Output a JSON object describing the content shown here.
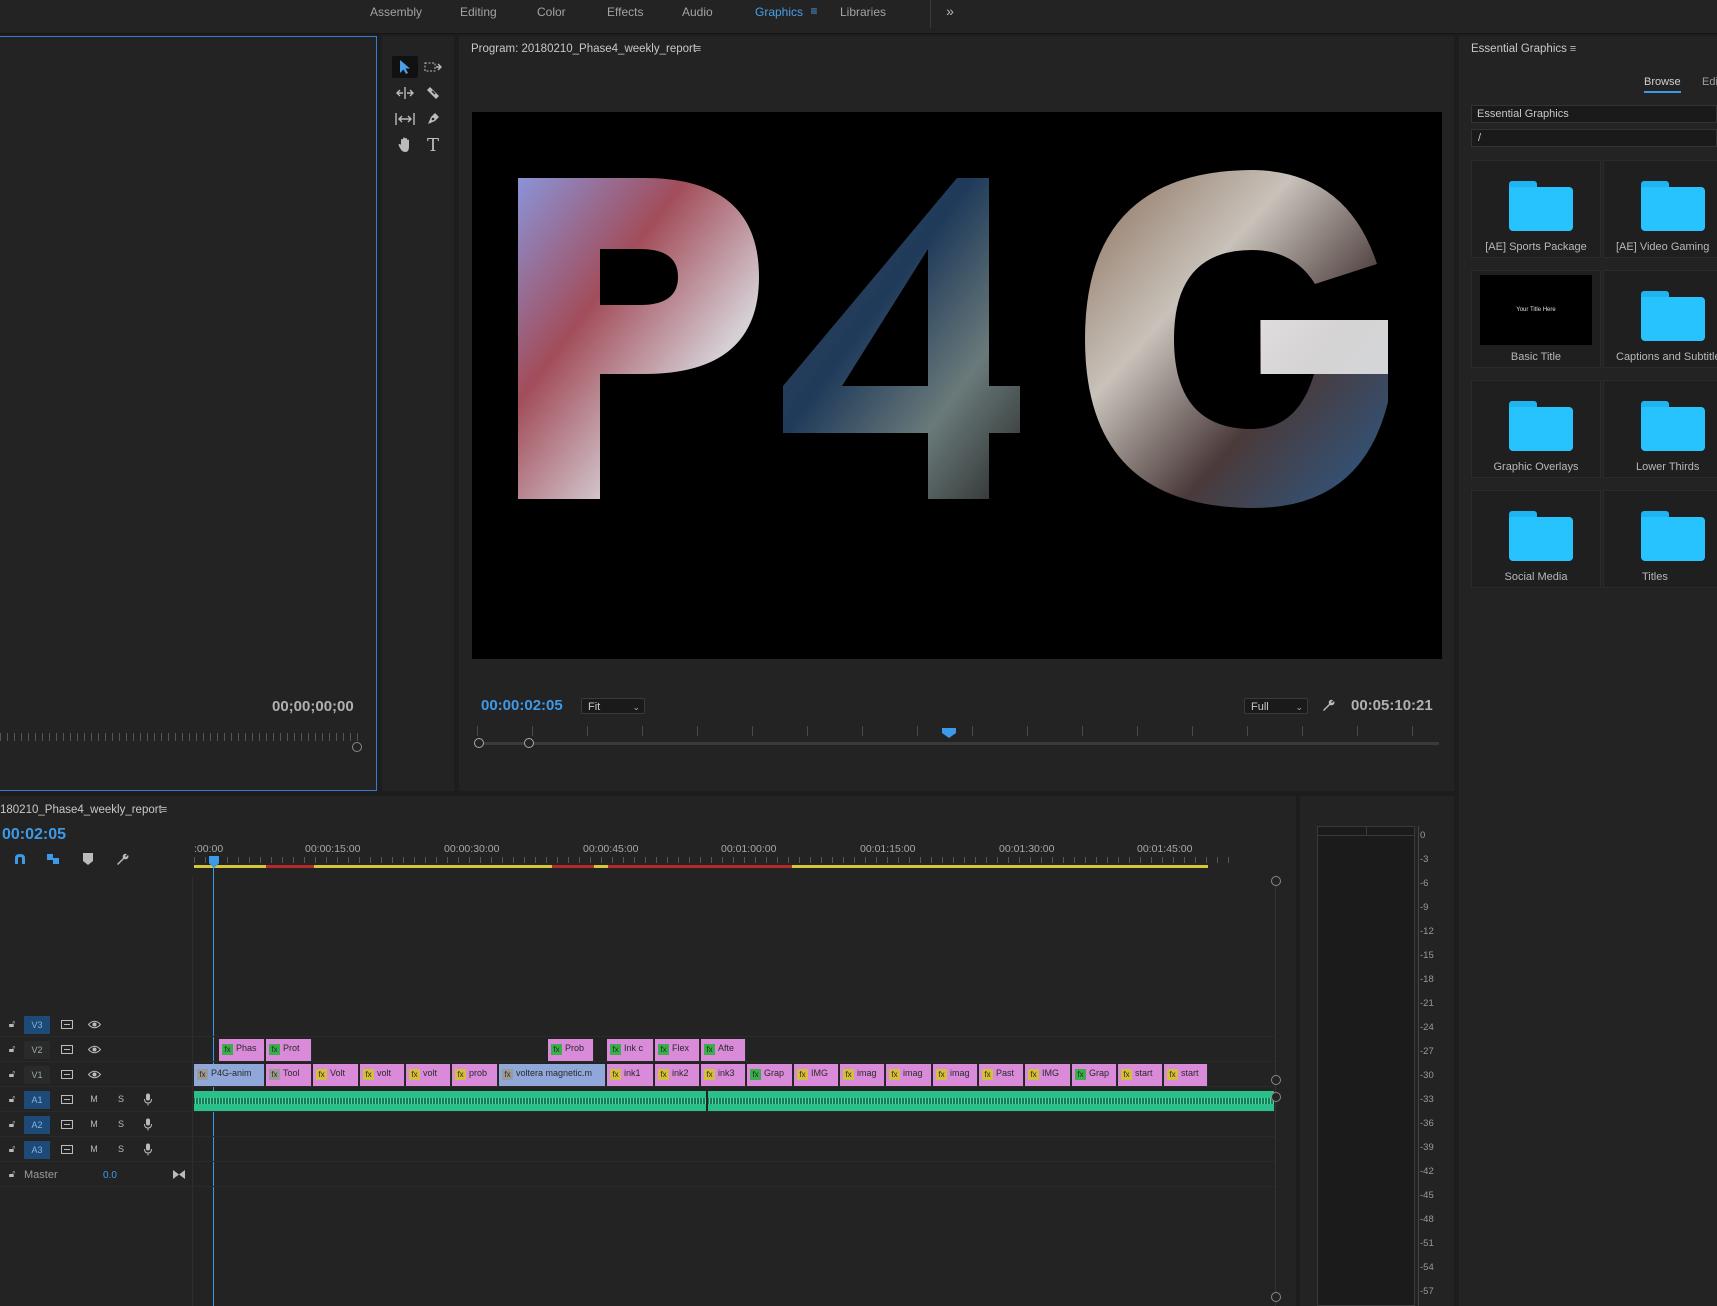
{
  "workspace_tabs": [
    {
      "label": "Assembly"
    },
    {
      "label": "Editing"
    },
    {
      "label": "Color"
    },
    {
      "label": "Effects"
    },
    {
      "label": "Audio"
    },
    {
      "label": "Graphics"
    },
    {
      "label": "Libraries"
    }
  ],
  "active_tab": "Graphics",
  "overflow_icon": "»",
  "source_monitor": {
    "timecode": "00;00;00;00"
  },
  "program_monitor": {
    "title": "Program: 20180210_Phase4_weekly_report",
    "current_timecode": "00:00:02:05",
    "fit_select": "Fit",
    "quality_select": "Full",
    "duration_timecode": "00:05:10:21",
    "video_text": "P4G"
  },
  "timeline": {
    "title": "180210_Phase4_weekly_report",
    "timecode": "00:02:05",
    "ruler_labels": [
      ":00:00",
      "00:00:15:00",
      "00:00:30:00",
      "00:00:45:00",
      "00:01:00:00",
      "00:01:15:00",
      "00:01:30:00",
      "00:01:45:00"
    ],
    "tracks": {
      "v3": "V3",
      "v2": "V2",
      "v1": "V1",
      "a1": "A1",
      "a2": "A2",
      "a3": "A3",
      "m": "M",
      "s": "S",
      "master": "Master",
      "master_value": "0.0"
    },
    "v2_clips": [
      "Phas",
      "Prot",
      "Prob",
      "Ink c",
      "Flex",
      "Afte"
    ],
    "v1_clips": [
      "P4G-anim",
      "Tool",
      "Volt",
      "volt",
      "volt",
      "prob",
      "voltera magnetic.m",
      "ink1",
      "ink2",
      "ink3",
      "Grap",
      "IMG",
      "imag",
      "imag",
      "imag",
      "Past",
      "IMG",
      "Grap",
      "start",
      "start"
    ]
  },
  "audio_meter": {
    "ticks": [
      "0",
      "-3",
      "-6",
      "-9",
      "-12",
      "-15",
      "-18",
      "-21",
      "-24",
      "-27",
      "-30",
      "-33",
      "-36",
      "-39",
      "-42",
      "-45",
      "-48",
      "-51",
      "-54",
      "-57"
    ]
  },
  "essential_graphics": {
    "title": "Essential Graphics",
    "tab_browse": "Browse",
    "tab_edit": "Edit",
    "source_dropdown": "Essential Graphics",
    "path": "/",
    "items": [
      {
        "name": "[AE] Sports Package"
      },
      {
        "name": "[AE] Video Gaming"
      },
      {
        "name": "Basic Title"
      },
      {
        "name": "Captions and Subtitles"
      },
      {
        "name": "Graphic Overlays"
      },
      {
        "name": "Lower Thirds"
      },
      {
        "name": "Social Media"
      },
      {
        "name": "Titles"
      }
    ],
    "basic_title_preview": "Your Title Here"
  },
  "colors": {
    "accent": "#3d9ae8",
    "folder": "#27c3ff",
    "clip_pink": "#d98ad9",
    "clip_blue": "#8fa8d9",
    "audio_clip": "#2bbf8a",
    "track_badge": "#1e4a78",
    "playhead": "#3d9ae8"
  }
}
